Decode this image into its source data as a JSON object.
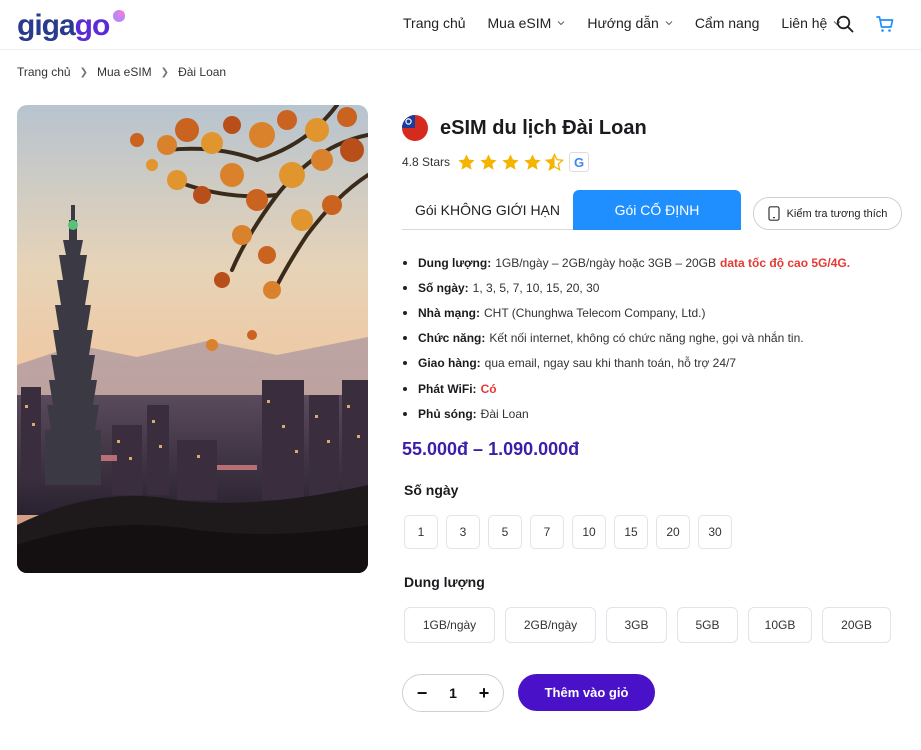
{
  "brand": {
    "logo_text_part1": "giga",
    "logo_text_part2": "go",
    "primary_color": "#4a12c8",
    "tab_active_color": "#1f8fff",
    "highlight_color": "#e53935"
  },
  "nav": {
    "items": [
      {
        "label": "Trang chủ",
        "has_dropdown": false
      },
      {
        "label": "Mua eSIM",
        "has_dropdown": true
      },
      {
        "label": "Hướng dẫn",
        "has_dropdown": true
      },
      {
        "label": "Cẩm nang",
        "has_dropdown": false
      },
      {
        "label": "Liên hệ",
        "has_dropdown": true
      }
    ],
    "icons": [
      "search-icon",
      "cart-icon"
    ]
  },
  "breadcrumb": [
    "Trang chủ",
    "Mua eSIM",
    "Đài Loan"
  ],
  "product": {
    "title": "eSIM du lịch Đài Loan",
    "flag_icon": "taiwan-flag-icon",
    "rating_label": "4.8 Stars",
    "rating_value": 4.5,
    "rating_max": 5,
    "rating_source_icon": "google-icon",
    "rating_source_letter": "G"
  },
  "tabs": {
    "unlimited_label": "Gói KHÔNG GIỚI HẠN",
    "fixed_label": "Gói CỐ ĐỊNH",
    "active": "fixed"
  },
  "compat_button": {
    "label": "Kiểm tra tương thích",
    "icon": "phone-icon"
  },
  "specs": [
    {
      "key": "Dung lượng:",
      "value": "1GB/ngày – 2GB/ngày hoặc 3GB – 20GB",
      "highlight": "data tốc độ cao 5G/4G."
    },
    {
      "key": "Số ngày:",
      "value": "1, 3, 5, 7, 10, 15, 20, 30",
      "highlight": ""
    },
    {
      "key": "Nhà mạng:",
      "value": "CHT (Chunghwa Telecom Company, Ltd.)",
      "highlight": ""
    },
    {
      "key": "Chức năng:",
      "value": "Kết nối internet, không có chức năng nghe, gọi và nhắn tin.",
      "highlight": ""
    },
    {
      "key": "Giao hàng:",
      "value": "qua email, ngay sau khi thanh toán, hỗ trợ 24/7",
      "highlight": ""
    },
    {
      "key": "Phát WiFi:",
      "value": "",
      "highlight": "Có"
    },
    {
      "key": "Phủ sóng:",
      "value": "Đài Loan",
      "highlight": ""
    }
  ],
  "price": "55.000đ – 1.090.000đ",
  "days": {
    "label": "Số ngày",
    "options": [
      "1",
      "3",
      "5",
      "7",
      "10",
      "15",
      "20",
      "30"
    ]
  },
  "capacity": {
    "label": "Dung lượng",
    "options": [
      "1GB/ngày",
      "2GB/ngày",
      "3GB",
      "5GB",
      "10GB",
      "20GB"
    ]
  },
  "quantity": {
    "minus": "−",
    "value": "1",
    "plus": "+"
  },
  "add_to_cart_label": "Thêm vào giỏ"
}
